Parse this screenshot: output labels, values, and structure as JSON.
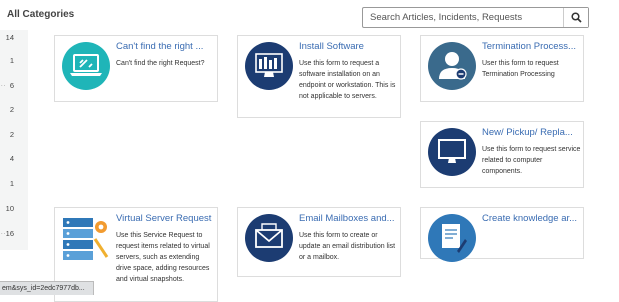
{
  "header": {
    "title": "All Categories"
  },
  "search": {
    "placeholder": "Search Articles, Incidents, Requests",
    "icon": "search-icon"
  },
  "sidebar": {
    "counts": [
      "14",
      "1",
      "6",
      "2",
      "2",
      "4",
      "1",
      "10",
      "16"
    ]
  },
  "cards": [
    {
      "title": "Can't find the right ...",
      "desc": "Can't find the right Request?",
      "icon": "laptop-tools-icon"
    },
    {
      "title": "Install Software",
      "desc": "Use this form to request a software installation on an endpoint or workstation. This is not applicable to servers.",
      "icon": "software-monitor-icon"
    },
    {
      "title": "Termination Process...",
      "desc": "User this form to request Termination Processing",
      "icon": "user-remove-icon"
    },
    {
      "title": "New/ Pickup/ Repla...",
      "desc": "Use this form to request service related to computer components.",
      "icon": "monitor-icon"
    },
    {
      "title": "Virtual Server Request",
      "desc": "Use this Service Request to request items related to virtual servers, such as extending drive space, adding resources and virtual snapshots.",
      "icon": "server-gear-icon"
    },
    {
      "title": "Email Mailboxes and...",
      "desc": "Use this form to create or update an email distribution list or a mailbox.",
      "icon": "envelope-icon"
    },
    {
      "title": "Create knowledge ar...",
      "desc": "",
      "icon": "document-edit-icon"
    }
  ],
  "status_bar": {
    "text": "em&sys_id=2edc7977db..."
  },
  "colors": {
    "accent": "#3a6cb2",
    "icon_navy": "#1c3c72",
    "icon_teal": "#1fb5b8",
    "icon_steel": "#3a6a8c"
  }
}
